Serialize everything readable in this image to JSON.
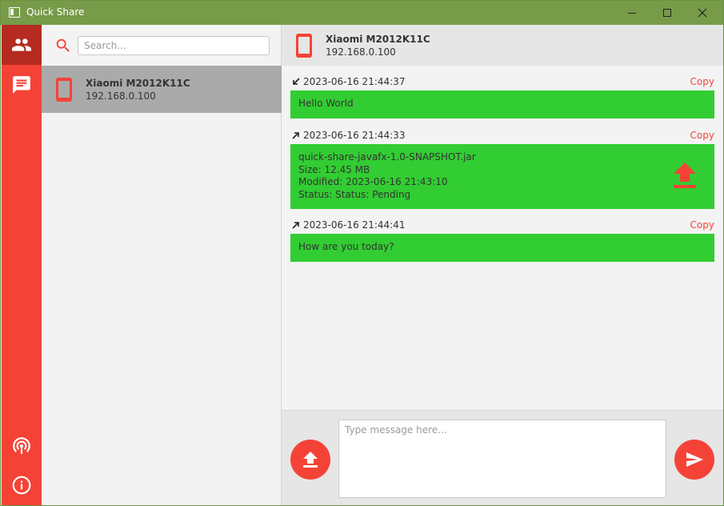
{
  "window": {
    "title": "Quick Share"
  },
  "sidebar": {
    "items": [
      {
        "icon": "people-icon",
        "active": true
      },
      {
        "icon": "chat-icon",
        "active": false
      },
      {
        "icon": "broadcast-icon",
        "active": false
      },
      {
        "icon": "info-icon",
        "active": false
      }
    ]
  },
  "devices": {
    "search_placeholder": "Search...",
    "items": [
      {
        "name": "Xiaomi M2012K11C",
        "ip": "192.168.0.100"
      }
    ]
  },
  "chat": {
    "device_name": "Xiaomi M2012K11C",
    "device_ip": "192.168.0.100",
    "copy_label": "Copy",
    "messages": [
      {
        "direction": "incoming",
        "timestamp": "2023-06-16 21:44:37",
        "text": "Hello World"
      },
      {
        "direction": "outgoing",
        "timestamp": "2023-06-16 21:44:33",
        "file": {
          "name": "quick-share-javafx-1.0-SNAPSHOT.jar",
          "size": "Size: 12.45 MB",
          "modified": "Modified: 2023-06-16 21:43:10",
          "status": "Status: Status: Pending"
        }
      },
      {
        "direction": "outgoing",
        "timestamp": "2023-06-16 21:44:41",
        "text": "How are you today?"
      }
    ],
    "input_placeholder": "Type message here..."
  },
  "colors": {
    "accent": "#f44336",
    "accent_dark": "#b52b22",
    "titlebar": "#779b48",
    "bubble": "#32cd32",
    "selected": "#aaaaaa"
  }
}
